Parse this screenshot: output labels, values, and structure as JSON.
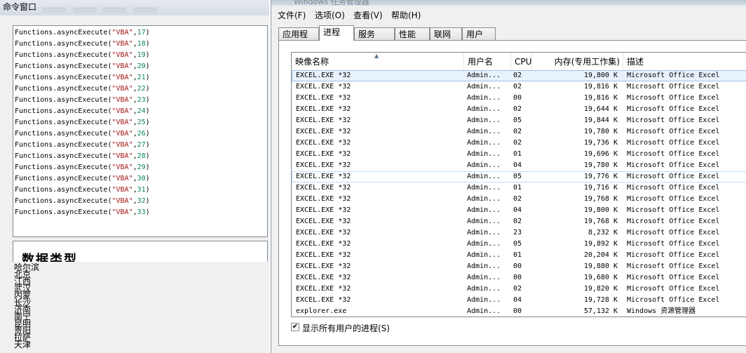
{
  "left_window": {
    "title": "命令窗口",
    "code_lines": [
      {
        "prefix": "Functions.asyncExecute(",
        "str": "\"VBA\"",
        "sep": ",",
        "num": "17",
        "suffix": ")"
      },
      {
        "prefix": "Functions.asyncExecute(",
        "str": "\"VBA\"",
        "sep": ",",
        "num": "18",
        "suffix": ")"
      },
      {
        "prefix": "Functions.asyncExecute(",
        "str": "\"VBA\"",
        "sep": ",",
        "num": "19",
        "suffix": ")"
      },
      {
        "prefix": "Functions.asyncExecute(",
        "str": "\"VBA\"",
        "sep": ",",
        "num": "20",
        "suffix": ")"
      },
      {
        "prefix": "Functions.asyncExecute(",
        "str": "\"VBA\"",
        "sep": ",",
        "num": "21",
        "suffix": ")"
      },
      {
        "prefix": "Functions.asyncExecute(",
        "str": "\"VBA\"",
        "sep": ",",
        "num": "22",
        "suffix": ")"
      },
      {
        "prefix": "Functions.asyncExecute(",
        "str": "\"VBA\"",
        "sep": ",",
        "num": "23",
        "suffix": ")"
      },
      {
        "prefix": "Functions.asyncExecute(",
        "str": "\"VBA\"",
        "sep": ",",
        "num": "24",
        "suffix": ")"
      },
      {
        "prefix": "Functions.asyncExecute(",
        "str": "\"VBA\"",
        "sep": ",",
        "num": "25",
        "suffix": ")"
      },
      {
        "prefix": "Functions.asyncExecute(",
        "str": "\"VBA\"",
        "sep": ",",
        "num": "26",
        "suffix": ")"
      },
      {
        "prefix": "Functions.asyncExecute(",
        "str": "\"VBA\"",
        "sep": ",",
        "num": "27",
        "suffix": ")"
      },
      {
        "prefix": "Functions.asyncExecute(",
        "str": "\"VBA\"",
        "sep": ",",
        "num": "28",
        "suffix": ")"
      },
      {
        "prefix": "Functions.asyncExecute(",
        "str": "\"VBA\"",
        "sep": ",",
        "num": "29",
        "suffix": ")"
      },
      {
        "prefix": "Functions.asyncExecute(",
        "str": "\"VBA\"",
        "sep": ",",
        "num": "30",
        "suffix": ")"
      },
      {
        "prefix": "Functions.asyncExecute(",
        "str": "\"VBA\"",
        "sep": ",",
        "num": "31",
        "suffix": ")"
      },
      {
        "prefix": "Functions.asyncExecute(",
        "str": "\"VBA\"",
        "sep": ",",
        "num": "32",
        "suffix": ")"
      },
      {
        "prefix": "Functions.asyncExecute(",
        "str": "\"VBA\"",
        "sep": ",",
        "num": "33",
        "suffix": ")"
      }
    ],
    "data_type_heading": "数据类型",
    "cities": [
      "哈尔滨",
      "北京",
      "江西",
      "武汉",
      "内蒙",
      "长沙",
      "济南",
      "南宁",
      "昆明",
      "贵阳",
      "拉萨",
      "天津"
    ]
  },
  "task_manager": {
    "title": "Windows 任务管理器",
    "menu": [
      "文件(F)",
      "选项(O)",
      "查看(V)",
      "帮助(H)"
    ],
    "tabs": [
      "应用程序",
      "进程",
      "服务",
      "性能",
      "联网",
      "用户"
    ],
    "active_tab": "进程",
    "columns": [
      "映像名称",
      "用户名",
      "CPU",
      "内存(专用工作集)",
      "描述"
    ],
    "rows": [
      {
        "image": "EXCEL.EXE *32",
        "user": "Admin...",
        "cpu": "02",
        "mem": "19,800 K",
        "desc": "Microsoft Office Excel"
      },
      {
        "image": "EXCEL.EXE *32",
        "user": "Admin...",
        "cpu": "02",
        "mem": "19,816 K",
        "desc": "Microsoft Office Excel"
      },
      {
        "image": "EXCEL.EXE *32",
        "user": "Admin...",
        "cpu": "00",
        "mem": "19,816 K",
        "desc": "Microsoft Office Excel"
      },
      {
        "image": "EXCEL.EXE *32",
        "user": "Admin...",
        "cpu": "02",
        "mem": "19,644 K",
        "desc": "Microsoft Office Excel"
      },
      {
        "image": "EXCEL.EXE *32",
        "user": "Admin...",
        "cpu": "05",
        "mem": "19,844 K",
        "desc": "Microsoft Office Excel"
      },
      {
        "image": "EXCEL.EXE *32",
        "user": "Admin...",
        "cpu": "02",
        "mem": "19,780 K",
        "desc": "Microsoft Office Excel"
      },
      {
        "image": "EXCEL.EXE *32",
        "user": "Admin...",
        "cpu": "02",
        "mem": "19,736 K",
        "desc": "Microsoft Office Excel"
      },
      {
        "image": "EXCEL.EXE *32",
        "user": "Admin...",
        "cpu": "01",
        "mem": "19,696 K",
        "desc": "Microsoft Office Excel"
      },
      {
        "image": "EXCEL.EXE *32",
        "user": "Admin...",
        "cpu": "04",
        "mem": "19,780 K",
        "desc": "Microsoft Office Excel"
      },
      {
        "image": "EXCEL.EXE *32",
        "user": "Admin...",
        "cpu": "05",
        "mem": "19,776 K",
        "desc": "Microsoft Office Excel"
      },
      {
        "image": "EXCEL.EXE *32",
        "user": "Admin...",
        "cpu": "01",
        "mem": "19,716 K",
        "desc": "Microsoft Office Excel"
      },
      {
        "image": "EXCEL.EXE *32",
        "user": "Admin...",
        "cpu": "02",
        "mem": "19,768 K",
        "desc": "Microsoft Office Excel"
      },
      {
        "image": "EXCEL.EXE *32",
        "user": "Admin...",
        "cpu": "04",
        "mem": "19,800 K",
        "desc": "Microsoft Office Excel"
      },
      {
        "image": "EXCEL.EXE *32",
        "user": "Admin...",
        "cpu": "02",
        "mem": "19,768 K",
        "desc": "Microsoft Office Excel"
      },
      {
        "image": "EXCEL.EXE *32",
        "user": "Admin...",
        "cpu": "23",
        "mem": "8,232 K",
        "desc": "Microsoft Office Excel"
      },
      {
        "image": "EXCEL.EXE *32",
        "user": "Admin...",
        "cpu": "05",
        "mem": "19,892 K",
        "desc": "Microsoft Office Excel"
      },
      {
        "image": "EXCEL.EXE *32",
        "user": "Admin...",
        "cpu": "01",
        "mem": "20,204 K",
        "desc": "Microsoft Office Excel"
      },
      {
        "image": "EXCEL.EXE *32",
        "user": "Admin...",
        "cpu": "00",
        "mem": "19,880 K",
        "desc": "Microsoft Office Excel"
      },
      {
        "image": "EXCEL.EXE *32",
        "user": "Admin...",
        "cpu": "00",
        "mem": "19,680 K",
        "desc": "Microsoft Office Excel"
      },
      {
        "image": "EXCEL.EXE *32",
        "user": "Admin...",
        "cpu": "02",
        "mem": "19,820 K",
        "desc": "Microsoft Office Excel"
      },
      {
        "image": "EXCEL.EXE *32",
        "user": "Admin...",
        "cpu": "04",
        "mem": "19,728 K",
        "desc": "Microsoft Office Excel"
      },
      {
        "image": "explorer.exe",
        "user": "Admin...",
        "cpu": "00",
        "mem": "57,132 K",
        "desc": "Windows 资源管理器"
      }
    ],
    "show_all_users_label": "显示所有用户的进程(S)",
    "show_all_users_checked": true,
    "check_glyph": "✔",
    "sort_glyph": "▲"
  }
}
